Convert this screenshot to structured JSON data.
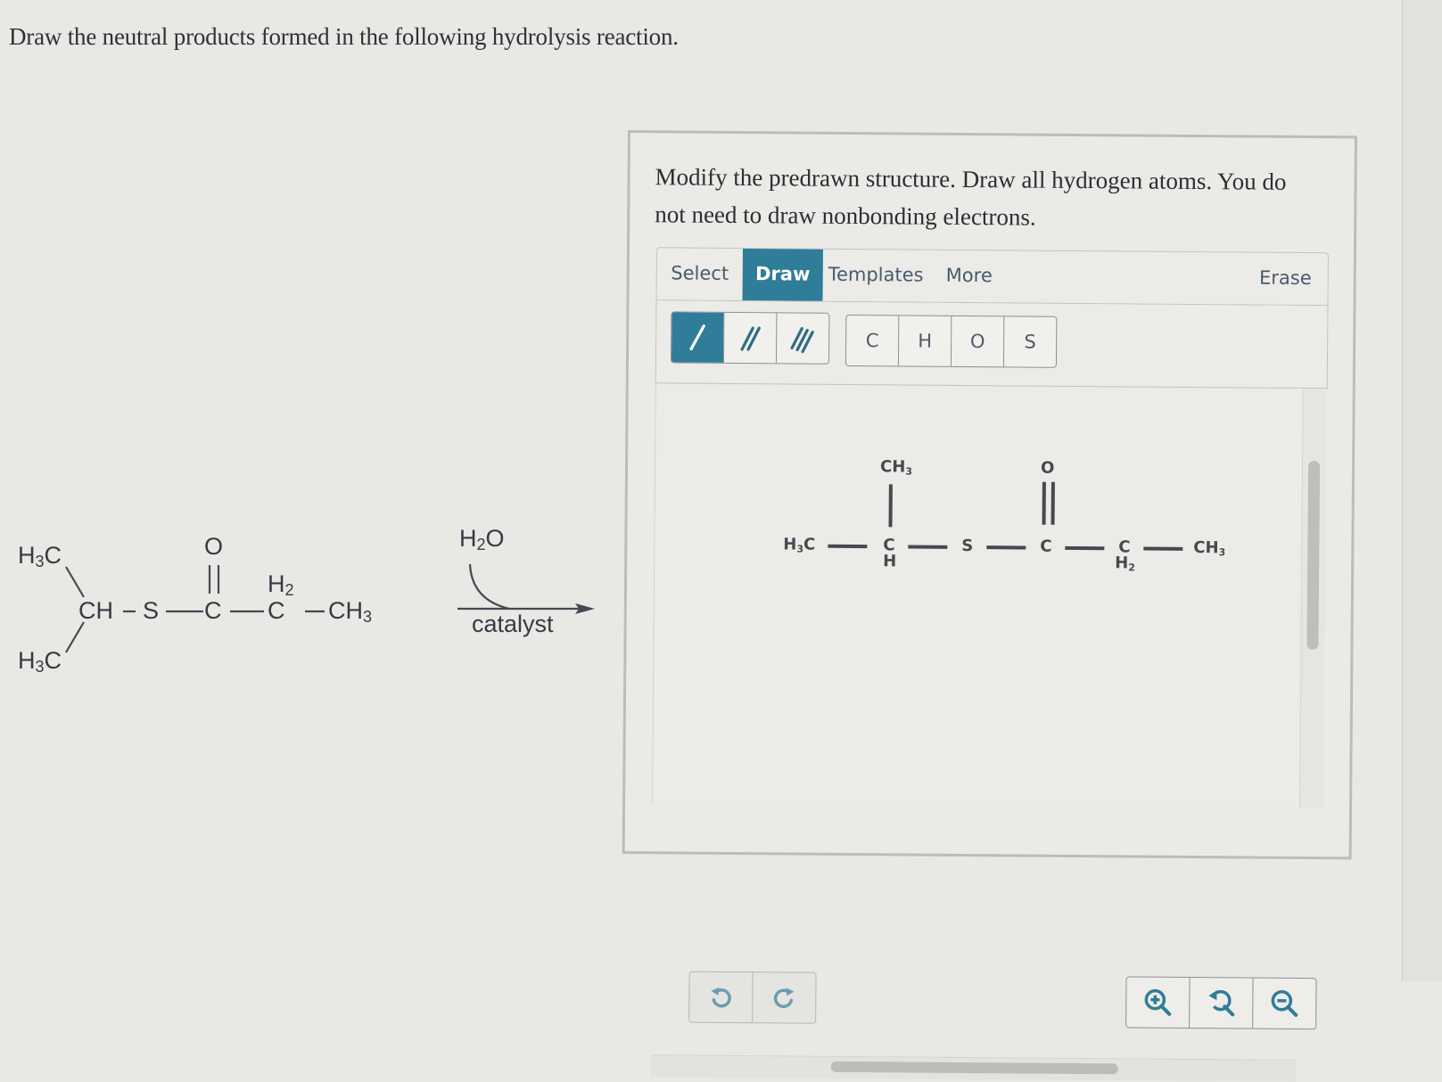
{
  "question": {
    "prompt": "Draw the neutral products formed in the following hydrolysis reaction."
  },
  "reaction": {
    "reactant": {
      "top_methyl": "H3C",
      "bottom_methyl": "H3C",
      "methine": "CH",
      "sulfur": "S",
      "carbonyl_carbon": "C",
      "carbonyl_oxygen": "O",
      "methylene": "C",
      "methylene_h": "H2",
      "terminal_methyl": "CH3"
    },
    "reagent_above": "H2O",
    "reagent_below": "catalyst"
  },
  "editor": {
    "instructions": "Modify the predrawn structure. Draw all hydrogen atoms. You do not need to draw nonbonding electrons.",
    "tabs": [
      {
        "label": "Select",
        "active": false
      },
      {
        "label": "Draw",
        "active": true
      },
      {
        "label": "Templates",
        "active": false
      },
      {
        "label": "More",
        "active": false
      }
    ],
    "erase_label": "Erase",
    "bond_tools": [
      {
        "name": "single-bond",
        "active": true
      },
      {
        "name": "double-bond",
        "active": false
      },
      {
        "name": "triple-bond",
        "active": false
      }
    ],
    "atom_tools": [
      "C",
      "H",
      "O",
      "S"
    ],
    "predrawn": {
      "left_methyl": "H3C",
      "ch_c": "C",
      "ch_h": "H",
      "top_methyl": "CH3",
      "sulfur": "S",
      "carbonyl_c": "C",
      "carbonyl_o": "O",
      "ch2_c": "C",
      "ch2_h": "H2",
      "terminal_methyl": "CH3"
    },
    "history_buttons": [
      "undo",
      "redo"
    ],
    "view_buttons": [
      "zoom-in",
      "reset-zoom",
      "zoom-out"
    ],
    "accent_color": "#2f7d98"
  }
}
